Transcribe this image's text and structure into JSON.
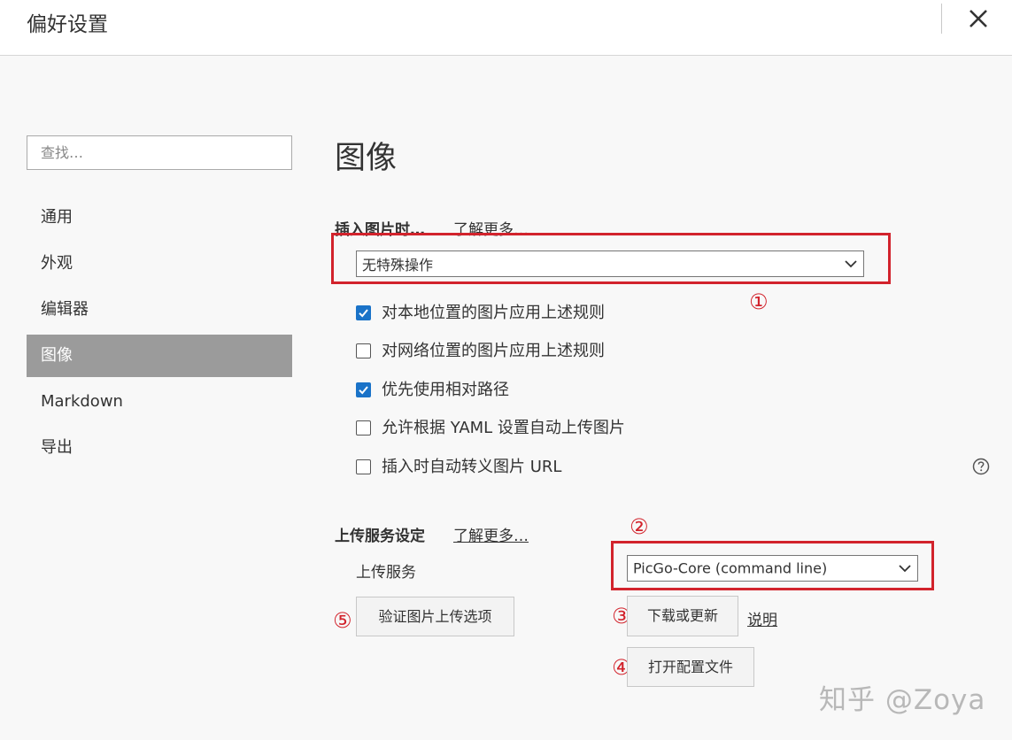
{
  "window": {
    "title": "偏好设置"
  },
  "sidebar": {
    "search_placeholder": "查找…",
    "items": [
      {
        "label": "通用"
      },
      {
        "label": "外观"
      },
      {
        "label": "编辑器"
      },
      {
        "label": "图像",
        "active": true
      },
      {
        "label": "Markdown"
      },
      {
        "label": "导出"
      }
    ]
  },
  "main": {
    "heading": "图像",
    "insert": {
      "title": "插入图片时…",
      "learn_more": "了解更多…",
      "selected": "无特殊操作",
      "marker": "①",
      "options": [
        {
          "label": "对本地位置的图片应用上述规则",
          "checked": true
        },
        {
          "label": "对网络位置的图片应用上述规则",
          "checked": false
        },
        {
          "label": "优先使用相对路径",
          "checked": true
        },
        {
          "label": "允许根据 YAML 设置自动上传图片",
          "checked": false
        },
        {
          "label": "插入时自动转义图片 URL",
          "checked": false
        }
      ]
    },
    "upload": {
      "title": "上传服务设定",
      "learn_more": "了解更多…",
      "service_label": "上传服务",
      "service_selected": "PicGo-Core (command line)",
      "marker_service": "②",
      "download_button": "下载或更新",
      "marker_download": "③",
      "explain_link": "说明",
      "open_config_button": "打开配置文件",
      "marker_config": "④",
      "verify_button": "验证图片上传选项",
      "marker_verify": "⑤"
    }
  },
  "watermark": "知乎 @Zoya",
  "colors": {
    "annotation_red": "#d2232c",
    "checkbox_blue": "#1a73c8",
    "active_nav": "#9b9b9b"
  },
  "icons": {
    "close": "close-icon",
    "chevron": "chevron-down-icon",
    "help": "help-icon",
    "check": "check-icon"
  }
}
